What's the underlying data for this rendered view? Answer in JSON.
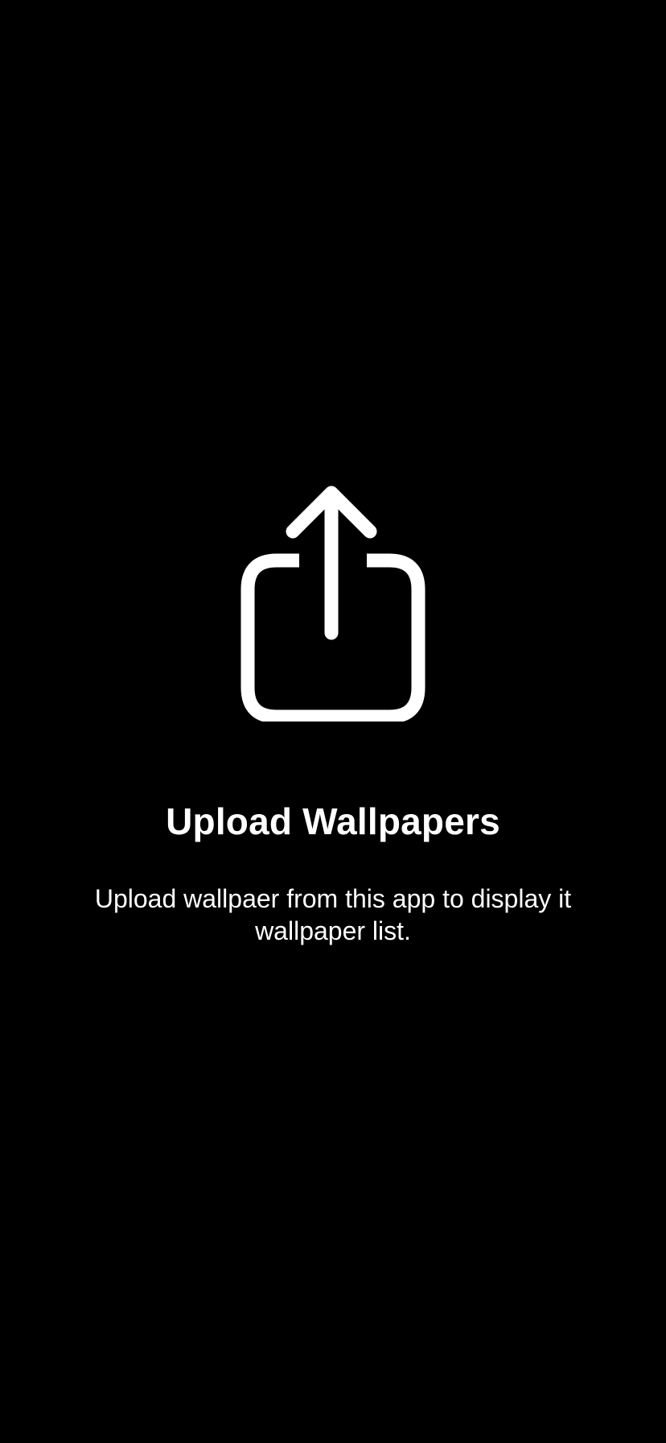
{
  "empty_state": {
    "icon": "share-upload-icon",
    "title": "Upload Wallpapers",
    "subtitle": "Upload wallpaer from this app to display it wallpaper list."
  },
  "colors": {
    "background": "#000000",
    "foreground": "#ffffff"
  }
}
